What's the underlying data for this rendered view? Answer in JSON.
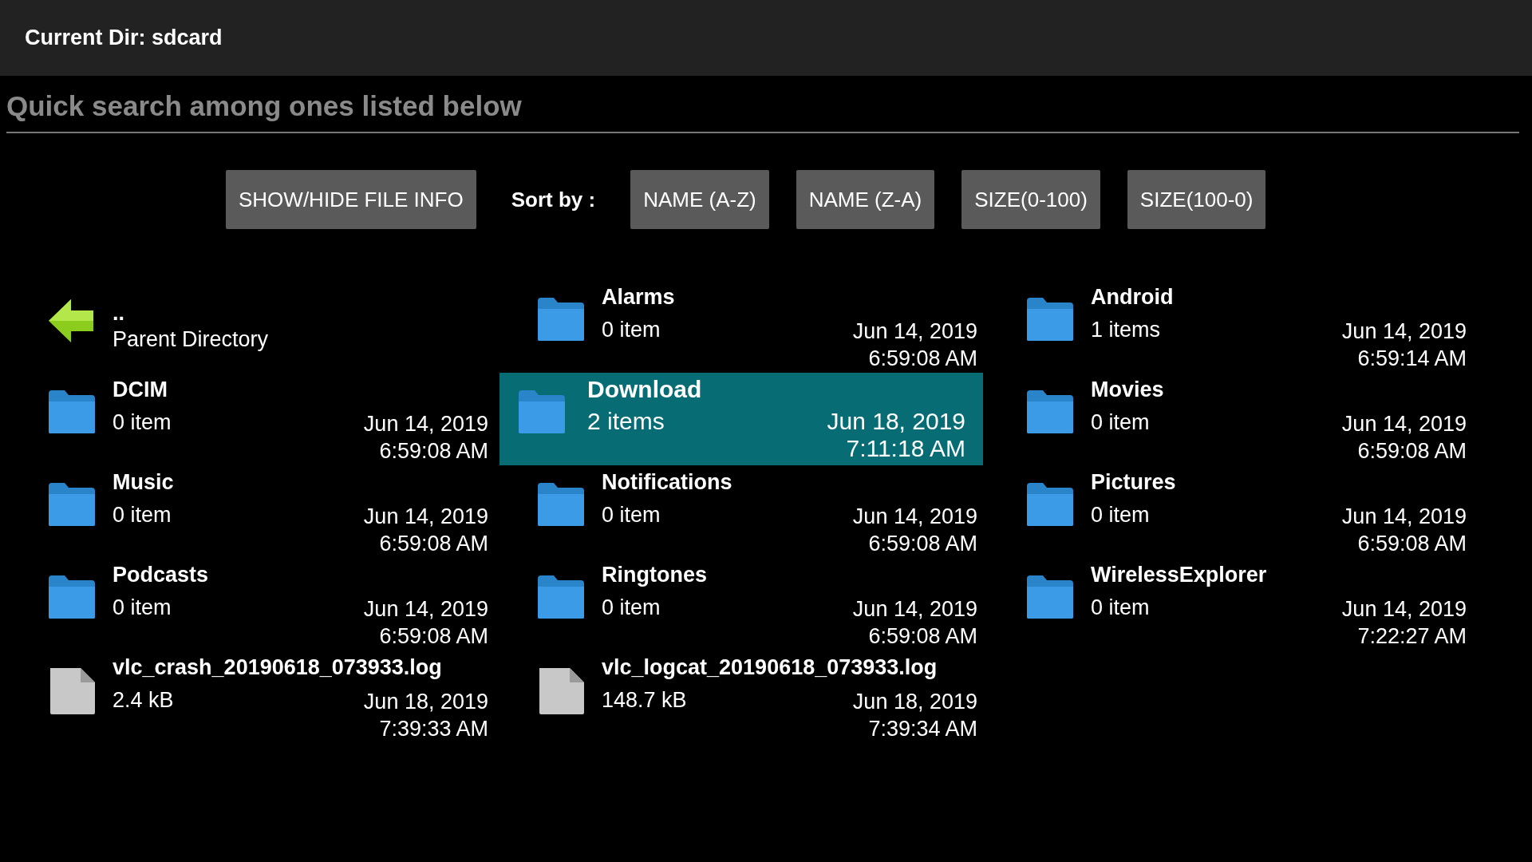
{
  "header": {
    "title": "Current Dir: sdcard"
  },
  "search": {
    "placeholder": "Quick search among ones listed below"
  },
  "toolbar": {
    "info_button": "SHOW/HIDE FILE INFO",
    "sort_label": "Sort by :",
    "sort_buttons": [
      "NAME (A-Z)",
      "NAME (Z-A)",
      "SIZE(0-100)",
      "SIZE(100-0)"
    ]
  },
  "items": [
    {
      "kind": "parent",
      "name": "..",
      "detail": "Parent Directory",
      "selected": false
    },
    {
      "kind": "folder",
      "name": "Alarms",
      "detail": "0 item",
      "date": "Jun 14, 2019",
      "time": "6:59:08 AM",
      "selected": false
    },
    {
      "kind": "folder",
      "name": "Android",
      "detail": "1 items",
      "date": "Jun 14, 2019",
      "time": "6:59:14 AM",
      "selected": false
    },
    {
      "kind": "folder",
      "name": "DCIM",
      "detail": "0 item",
      "date": "Jun 14, 2019",
      "time": "6:59:08 AM",
      "selected": false
    },
    {
      "kind": "folder",
      "name": "Download",
      "detail": "2 items",
      "date": "Jun 18, 2019",
      "time": "7:11:18 AM",
      "selected": true
    },
    {
      "kind": "folder",
      "name": "Movies",
      "detail": "0 item",
      "date": "Jun 14, 2019",
      "time": "6:59:08 AM",
      "selected": false
    },
    {
      "kind": "folder",
      "name": "Music",
      "detail": "0 item",
      "date": "Jun 14, 2019",
      "time": "6:59:08 AM",
      "selected": false
    },
    {
      "kind": "folder",
      "name": "Notifications",
      "detail": "0 item",
      "date": "Jun 14, 2019",
      "time": "6:59:08 AM",
      "selected": false
    },
    {
      "kind": "folder",
      "name": "Pictures",
      "detail": "0 item",
      "date": "Jun 14, 2019",
      "time": "6:59:08 AM",
      "selected": false
    },
    {
      "kind": "folder",
      "name": "Podcasts",
      "detail": "0 item",
      "date": "Jun 14, 2019",
      "time": "6:59:08 AM",
      "selected": false
    },
    {
      "kind": "folder",
      "name": "Ringtones",
      "detail": "0 item",
      "date": "Jun 14, 2019",
      "time": "6:59:08 AM",
      "selected": false
    },
    {
      "kind": "folder",
      "name": "WirelessExplorer",
      "detail": "0 item",
      "date": "Jun 14, 2019",
      "time": "7:22:27 AM",
      "selected": false
    },
    {
      "kind": "file",
      "name": "vlc_crash_20190618_073933.log",
      "detail": "2.4 kB",
      "date": "Jun 18, 2019",
      "time": "7:39:33 AM",
      "selected": false
    },
    {
      "kind": "file",
      "name": "vlc_logcat_20190618_073933.log",
      "detail": "148.7 kB",
      "date": "Jun 18, 2019",
      "time": "7:39:34 AM",
      "selected": false
    }
  ]
}
